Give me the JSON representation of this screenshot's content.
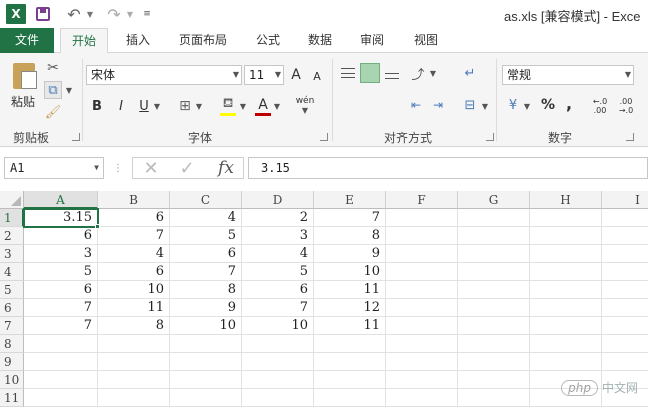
{
  "titlebar": {
    "logo_text": "X",
    "window_title": "as.xls  [兼容模式] - Exce"
  },
  "tabs": [
    {
      "label": "文件"
    },
    {
      "label": "开始"
    },
    {
      "label": "插入"
    },
    {
      "label": "页面布局"
    },
    {
      "label": "公式"
    },
    {
      "label": "数据"
    },
    {
      "label": "审阅"
    },
    {
      "label": "视图"
    }
  ],
  "ribbon": {
    "clipboard": {
      "paste_label": "粘贴",
      "group_label": "剪贴板"
    },
    "font": {
      "font_name": "宋体",
      "font_size": "11",
      "grow": "A",
      "shrink": "A",
      "bold": "B",
      "italic": "I",
      "underline": "U",
      "font_color_glyph": "A",
      "phonetic": "wén",
      "group_label": "字体"
    },
    "alignment": {
      "group_label": "对齐方式"
    },
    "number": {
      "format": "常规",
      "currency": "¥",
      "percent": "%",
      "comma": ",",
      "inc_dec": "←.0\n.00",
      "dec_dec": ".00\n→.0",
      "group_label": "数字"
    }
  },
  "formula_bar": {
    "name_box": "A1",
    "fx": "fx",
    "content": "3.15"
  },
  "sheet": {
    "columns": [
      "A",
      "B",
      "C",
      "D",
      "E",
      "F",
      "G",
      "H",
      "I"
    ],
    "rows": [
      {
        "num": "1",
        "cells": [
          "3.15",
          "6",
          "4",
          "2",
          "7"
        ]
      },
      {
        "num": "2",
        "cells": [
          "6",
          "7",
          "5",
          "3",
          "8"
        ]
      },
      {
        "num": "3",
        "cells": [
          "3",
          "4",
          "6",
          "4",
          "9"
        ]
      },
      {
        "num": "4",
        "cells": [
          "5",
          "6",
          "7",
          "5",
          "10"
        ]
      },
      {
        "num": "5",
        "cells": [
          "6",
          "10",
          "8",
          "6",
          "11"
        ]
      },
      {
        "num": "6",
        "cells": [
          "7",
          "11",
          "9",
          "7",
          "12"
        ]
      },
      {
        "num": "7",
        "cells": [
          "7",
          "8",
          "10",
          "10",
          "11"
        ]
      },
      {
        "num": "8",
        "cells": []
      },
      {
        "num": "9",
        "cells": []
      },
      {
        "num": "10",
        "cells": []
      },
      {
        "num": "11",
        "cells": []
      }
    ],
    "active_cell": "A1"
  },
  "watermark": {
    "badge": "php",
    "text": "中文网"
  },
  "colors": {
    "accent": "#217346",
    "font_color": "#c00000",
    "highlight": "#ffff00"
  }
}
